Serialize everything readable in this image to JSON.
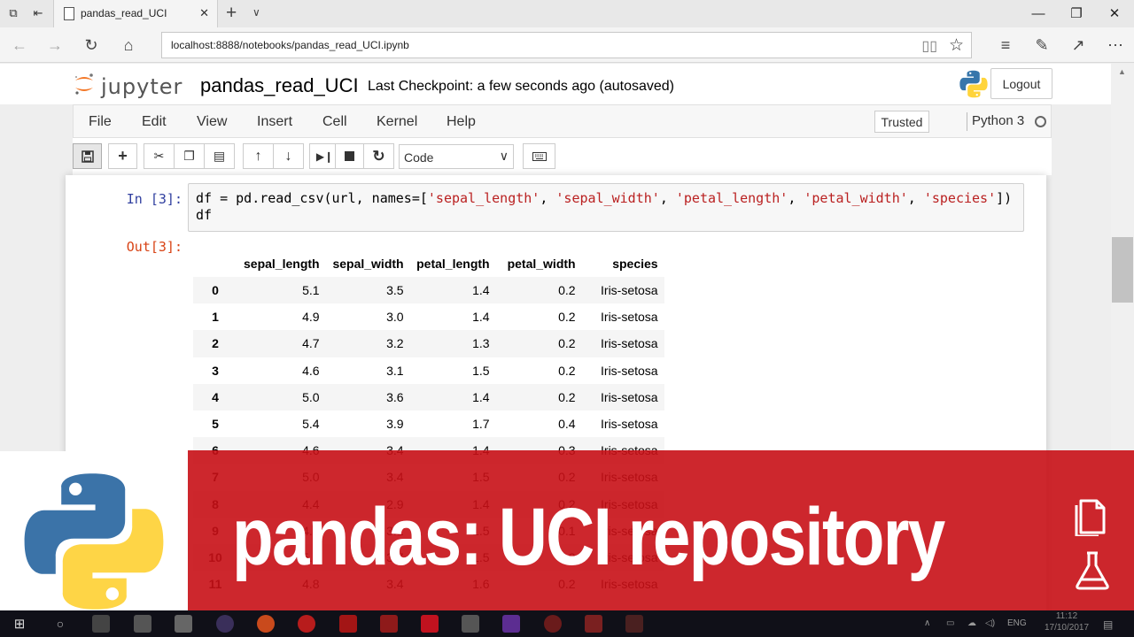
{
  "browser": {
    "tab_title": "pandas_read_UCI",
    "url": "localhost:8888/notebooks/pandas_read_UCI.ipynb"
  },
  "jupyter": {
    "logo_text": "jupyter",
    "notebook_name": "pandas_read_UCI",
    "checkpoint": "Last Checkpoint: a few seconds ago (autosaved)",
    "logout_label": "Logout",
    "menu": [
      "File",
      "Edit",
      "View",
      "Insert",
      "Cell",
      "Kernel",
      "Help"
    ],
    "trusted_label": "Trusted",
    "kernel_name": "Python 3",
    "cell_type": "Code"
  },
  "cell": {
    "in_prompt": "In [3]:",
    "out_prompt": "Out[3]:",
    "code_lines": [
      [
        {
          "t": "df = pd.read_csv(url, names=["
        },
        {
          "t": "'sepal_length'",
          "s": 1
        },
        {
          "t": ", "
        },
        {
          "t": "'sepal_width'",
          "s": 1
        },
        {
          "t": ", "
        },
        {
          "t": "'petal_length'",
          "s": 1
        },
        {
          "t": ", "
        },
        {
          "t": "'petal_width'",
          "s": 1
        },
        {
          "t": ", "
        },
        {
          "t": "'species'",
          "s": 1
        },
        {
          "t": "])"
        }
      ],
      [
        {
          "t": "df"
        }
      ]
    ]
  },
  "dataframe": {
    "columns": [
      "",
      "sepal_length",
      "sepal_width",
      "petal_length",
      "petal_width",
      "species"
    ],
    "rows": [
      [
        "0",
        "5.1",
        "3.5",
        "1.4",
        "0.2",
        "Iris-setosa"
      ],
      [
        "1",
        "4.9",
        "3.0",
        "1.4",
        "0.2",
        "Iris-setosa"
      ],
      [
        "2",
        "4.7",
        "3.2",
        "1.3",
        "0.2",
        "Iris-setosa"
      ],
      [
        "3",
        "4.6",
        "3.1",
        "1.5",
        "0.2",
        "Iris-setosa"
      ],
      [
        "4",
        "5.0",
        "3.6",
        "1.4",
        "0.2",
        "Iris-setosa"
      ],
      [
        "5",
        "5.4",
        "3.9",
        "1.7",
        "0.4",
        "Iris-setosa"
      ],
      [
        "6",
        "4.6",
        "3.4",
        "1.4",
        "0.3",
        "Iris-setosa"
      ],
      [
        "7",
        "5.0",
        "3.4",
        "1.5",
        "0.2",
        "Iris-setosa"
      ],
      [
        "8",
        "4.4",
        "2.9",
        "1.4",
        "0.2",
        "Iris-setosa"
      ],
      [
        "9",
        "4.9",
        "3.1",
        "1.5",
        "0.1",
        "Iris-setosa"
      ],
      [
        "10",
        "5.4",
        "3.7",
        "1.5",
        "0.2",
        "Iris-setosa"
      ],
      [
        "11",
        "4.8",
        "3.4",
        "1.6",
        "0.2",
        "Iris-setosa"
      ]
    ]
  },
  "banner": {
    "title": "pandas: UCI repository",
    "color": "#c81016"
  },
  "taskbar": {
    "language": "ENG",
    "time": "11:12",
    "date": "17/10/2017"
  }
}
